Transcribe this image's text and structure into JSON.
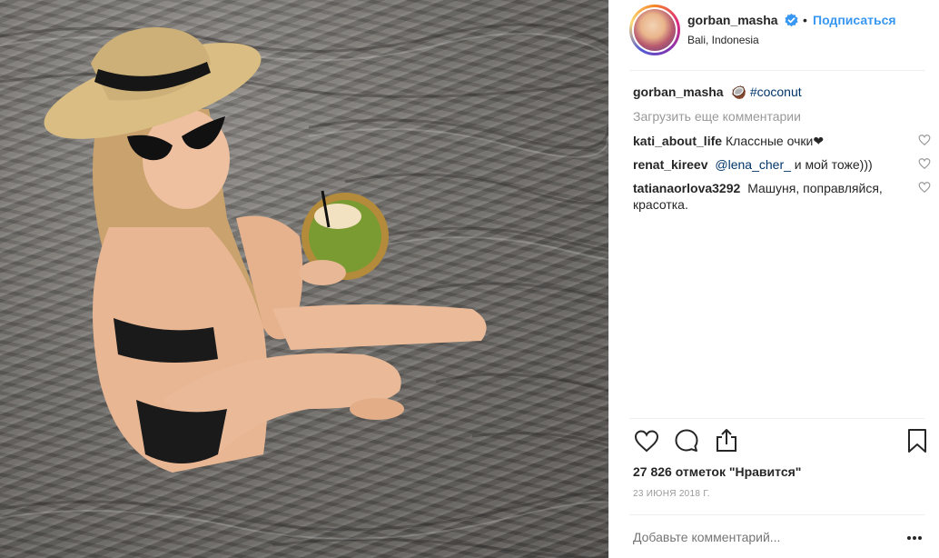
{
  "post": {
    "username": "gorban_masha",
    "follow_label": "Подписаться",
    "dot": "•",
    "location": "Bali, Indonesia",
    "verified_icon": "verified-badge-icon"
  },
  "caption": {
    "username": "gorban_masha",
    "emoji": "🥥",
    "hashtag": "#coconut"
  },
  "load_more_label": "Загрузить еще комментарии",
  "comments": [
    {
      "username": "kati_about_life",
      "text": "Классные очки",
      "suffix": "❤"
    },
    {
      "username": "renat_kireev",
      "mention": "@lena_cher_",
      "text": "и мой тоже)))"
    },
    {
      "username": "tatianaorlova3292",
      "text": "Машуня, поправляйся, красотка."
    }
  ],
  "actions": {
    "like_icon": "heart-icon",
    "comment_icon": "comment-icon",
    "share_icon": "share-icon",
    "save_icon": "bookmark-icon"
  },
  "likes_text": "27 826 отметок \"Нравится\"",
  "date_text": "23 ИЮНЯ 2018 Г.",
  "add_comment_placeholder": "Добавьте комментарий...",
  "colors": {
    "accent": "#3897f0",
    "link": "#003569",
    "muted": "#999999",
    "text": "#262626"
  }
}
